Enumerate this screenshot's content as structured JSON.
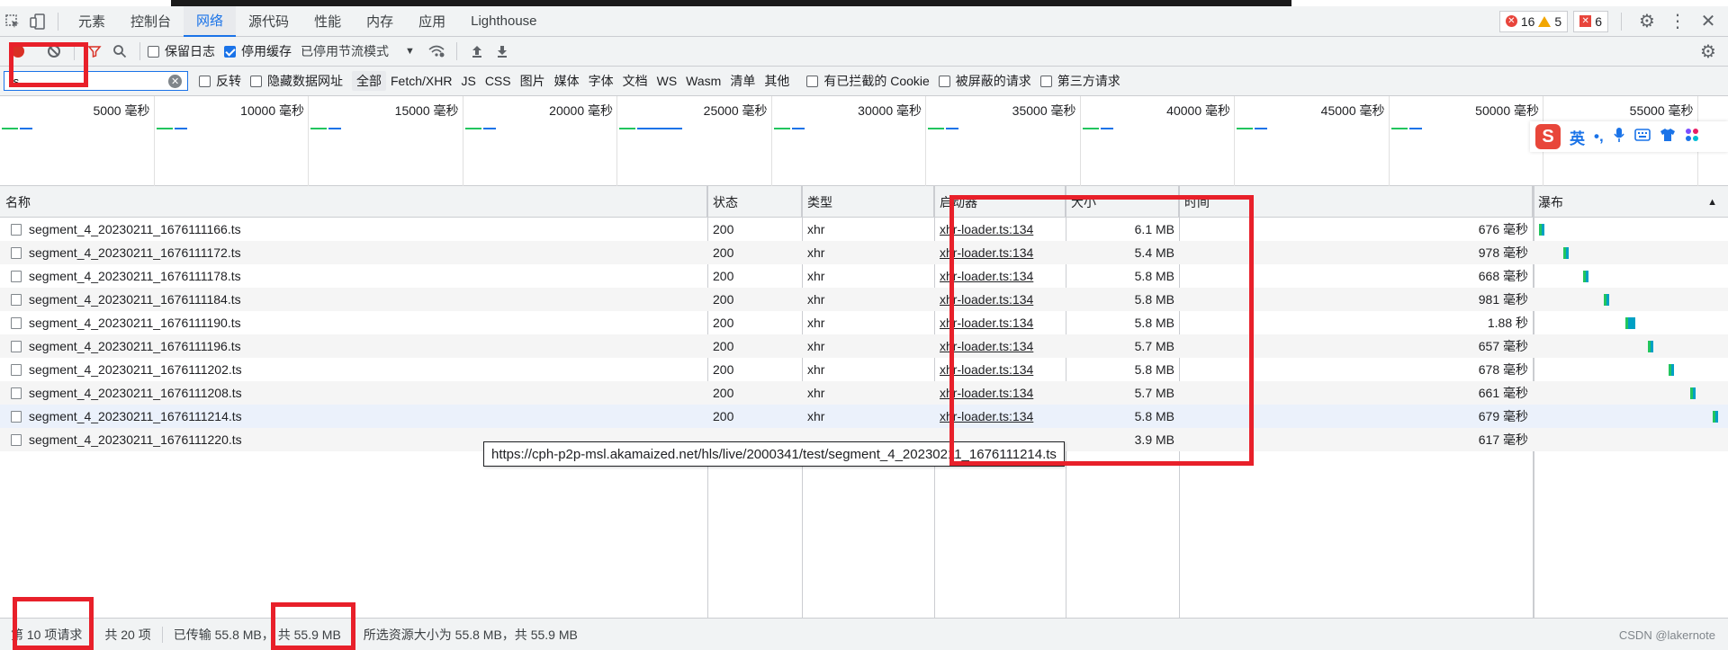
{
  "tabs": {
    "items": [
      "元素",
      "控制台",
      "网络",
      "源代码",
      "性能",
      "内存",
      "应用",
      "Lighthouse"
    ],
    "active_index": 2,
    "errors_count": "16",
    "warnings_count": "5",
    "issues_count": "6"
  },
  "toolbar": {
    "preserve_log": "保留日志",
    "disable_cache": "停用缓存",
    "throttling": "已停用节流模式"
  },
  "filter": {
    "value": "ts",
    "invert": "反转",
    "hide_data_urls": "隐藏数据网址",
    "types": [
      "全部",
      "Fetch/XHR",
      "JS",
      "CSS",
      "图片",
      "媒体",
      "字体",
      "文档",
      "WS",
      "Wasm",
      "清单",
      "其他"
    ],
    "active_type": 0,
    "blocked_cookies": "有已拦截的 Cookie",
    "blocked_requests": "被屏蔽的请求",
    "third_party": "第三方请求"
  },
  "overview": {
    "labels": [
      "5000 毫秒",
      "10000 毫秒",
      "15000 毫秒",
      "20000 毫秒",
      "25000 毫秒",
      "30000 毫秒",
      "35000 毫秒",
      "40000 毫秒",
      "45000 毫秒",
      "50000 毫秒",
      "55000 毫秒"
    ]
  },
  "ime": {
    "logo": "S",
    "mode": "英",
    "punct": "•,"
  },
  "columns": {
    "name": "名称",
    "status": "状态",
    "type": "类型",
    "initiator": "启动器",
    "size": "大小",
    "time": "时间",
    "waterfall": "瀑布"
  },
  "requests": [
    {
      "name": "segment_4_20230211_1676111166.ts",
      "status": "200",
      "type": "xhr",
      "initiator": "xhr-loader.ts:134",
      "size": "6.1 MB",
      "time": "676 毫秒",
      "wf_start": 0.01,
      "wf_width": 0.02
    },
    {
      "name": "segment_4_20230211_1676111172.ts",
      "status": "200",
      "type": "xhr",
      "initiator": "xhr-loader.ts:134",
      "size": "5.4 MB",
      "time": "978 毫秒",
      "wf_start": 0.14,
      "wf_width": 0.03
    },
    {
      "name": "segment_4_20230211_1676111178.ts",
      "status": "200",
      "type": "xhr",
      "initiator": "xhr-loader.ts:134",
      "size": "5.8 MB",
      "time": "668 毫秒",
      "wf_start": 0.25,
      "wf_width": 0.02
    },
    {
      "name": "segment_4_20230211_1676111184.ts",
      "status": "200",
      "type": "xhr",
      "initiator": "xhr-loader.ts:134",
      "size": "5.8 MB",
      "time": "981 毫秒",
      "wf_start": 0.36,
      "wf_width": 0.03
    },
    {
      "name": "segment_4_20230211_1676111190.ts",
      "status": "200",
      "type": "xhr",
      "initiator": "xhr-loader.ts:134",
      "size": "5.8 MB",
      "time": "1.88 秒",
      "wf_start": 0.48,
      "wf_width": 0.05
    },
    {
      "name": "segment_4_20230211_1676111196.ts",
      "status": "200",
      "type": "xhr",
      "initiator": "xhr-loader.ts:134",
      "size": "5.7 MB",
      "time": "657 毫秒",
      "wf_start": 0.6,
      "wf_width": 0.02
    },
    {
      "name": "segment_4_20230211_1676111202.ts",
      "status": "200",
      "type": "xhr",
      "initiator": "xhr-loader.ts:134",
      "size": "5.8 MB",
      "time": "678 毫秒",
      "wf_start": 0.71,
      "wf_width": 0.02
    },
    {
      "name": "segment_4_20230211_1676111208.ts",
      "status": "200",
      "type": "xhr",
      "initiator": "xhr-loader.ts:134",
      "size": "5.7 MB",
      "time": "661 毫秒",
      "wf_start": 0.83,
      "wf_width": 0.02
    },
    {
      "name": "segment_4_20230211_1676111214.ts",
      "status": "200",
      "type": "xhr",
      "initiator": "xhr-loader.ts:134",
      "size": "5.8 MB",
      "time": "679 毫秒",
      "wf_start": 0.95,
      "wf_width": 0.02
    },
    {
      "name": "segment_4_20230211_1676111220.ts",
      "status": "",
      "type": "",
      "initiator": "",
      "size": "3.9 MB",
      "time": "617 毫秒",
      "wf_start": 0,
      "wf_width": 0
    }
  ],
  "tooltip": "https://cph-p2p-msl.akamaized.net/hls/live/2000341/test/segment_4_20230211_1676111214.ts",
  "status": {
    "requests": "第 10 项请求",
    "total": "共 20 项",
    "transferred": "已传输 55.8 MB，",
    "transferred_total": "共 55.9 MB",
    "resources": "所选资源大小为 55.8 MB，共 55.9 MB",
    "watermark": "CSDN @lakernote"
  }
}
